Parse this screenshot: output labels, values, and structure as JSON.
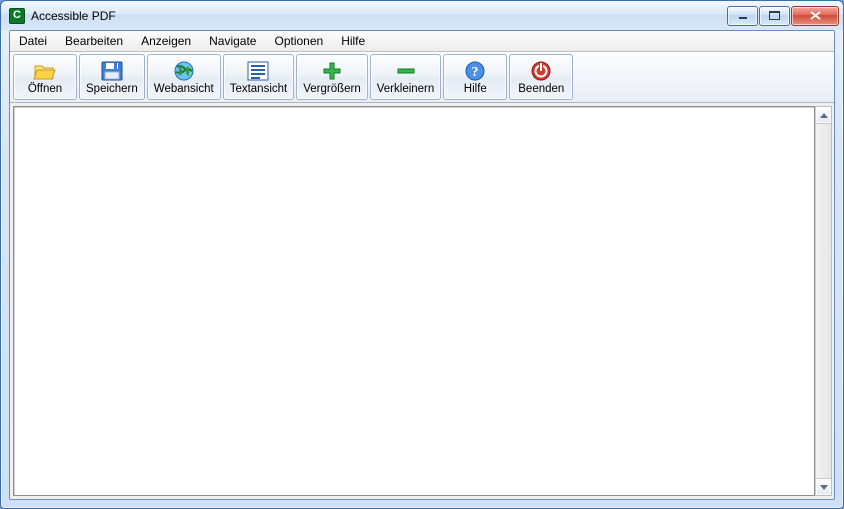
{
  "window": {
    "title": "Accessible PDF"
  },
  "menu": {
    "items": [
      {
        "label": "Datei"
      },
      {
        "label": "Bearbeiten"
      },
      {
        "label": "Anzeigen"
      },
      {
        "label": "Navigate"
      },
      {
        "label": "Optionen"
      },
      {
        "label": "Hilfe"
      }
    ]
  },
  "toolbar": {
    "items": [
      {
        "name": "open",
        "label": "Öffnen",
        "icon": "folder-open-icon"
      },
      {
        "name": "save",
        "label": "Speichern",
        "icon": "save-icon"
      },
      {
        "name": "webview",
        "label": "Webansicht",
        "icon": "globe-icon"
      },
      {
        "name": "textview",
        "label": "Textansicht",
        "icon": "text-view-icon"
      },
      {
        "name": "zoom-in",
        "label": "Vergrößern",
        "icon": "plus-icon"
      },
      {
        "name": "zoom-out",
        "label": "Verkleinern",
        "icon": "minus-icon"
      },
      {
        "name": "help",
        "label": "Hilfe",
        "icon": "help-icon"
      },
      {
        "name": "exit",
        "label": "Beenden",
        "icon": "power-icon"
      }
    ]
  }
}
